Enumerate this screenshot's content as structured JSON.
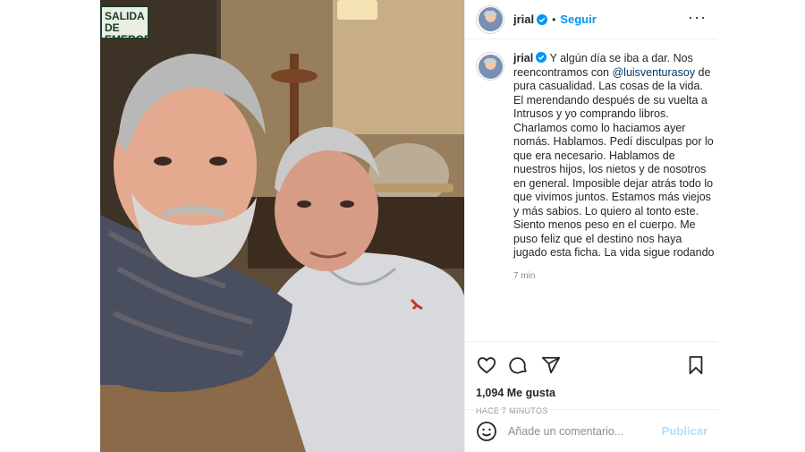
{
  "header": {
    "username": "jrial",
    "separator": "•",
    "follow_label": "Seguir",
    "more_icon": "more-horizontal-icon"
  },
  "photo": {
    "sign_text": "SALIDA\nDE EMERGENCIA",
    "alt": "selfie"
  },
  "caption": {
    "username": "jrial",
    "text_before_mention": " Y algún día se iba a dar. Nos reencontramos con ",
    "mention": "@luisventurasoy",
    "text_after_mention": " de pura casualidad. Las cosas de la vida. El merendando después de su vuelta a Intrusos y yo comprando libros. Charlamos como lo haciamos ayer nomás. Hablamos. Pedí disculpas por lo que era necesario. Hablamos de nuestros hijos, los nietos y de nosotros en general. Imposible dejar atrás todo lo que vivimos juntos. Estamos más viejos y más sabios. Lo quiero al tonto este. Siento menos peso en el cuerpo. Me puso feliz que el destino nos haya jugado esta ficha. La vida sigue rodando",
    "time": "7 min"
  },
  "actions": {
    "icons": [
      "heart-icon",
      "comment-icon",
      "share-icon",
      "bookmark-icon"
    ],
    "likes": "1,094 Me gusta",
    "posted_ago": "HACE 7 MINUTOS"
  },
  "comment": {
    "placeholder": "Añade un comentario...",
    "publish_label": "Publicar",
    "emoji_icon": "emoji-icon"
  },
  "colors": {
    "accent": "#0095f6",
    "mention": "#00376b",
    "publish_disabled": "#b2dffc",
    "muted": "#8e8e8e"
  }
}
